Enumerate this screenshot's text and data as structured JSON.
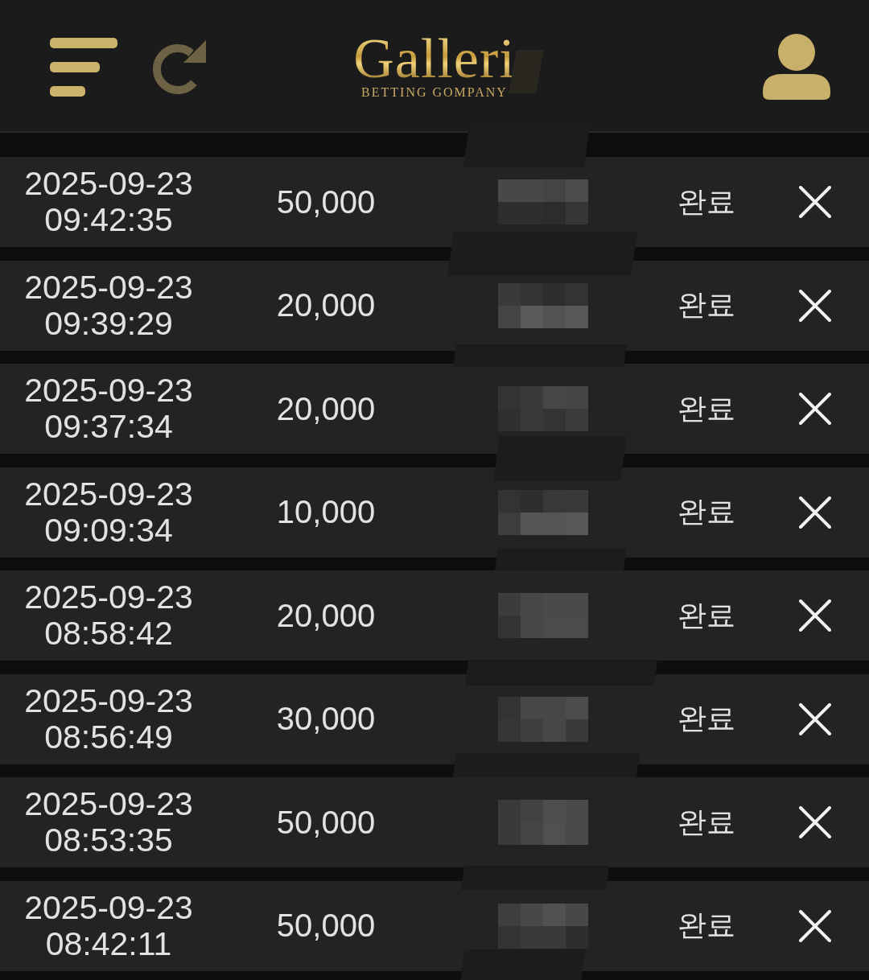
{
  "header": {
    "logo": {
      "title": "Galleri",
      "subtitle": "BETTING GOMPANY"
    }
  },
  "transactions": [
    {
      "date": "2025-09-23",
      "time": "09:42:35",
      "amount": "50,000",
      "status": "완료"
    },
    {
      "date": "2025-09-23",
      "time": "09:39:29",
      "amount": "20,000",
      "status": "완료"
    },
    {
      "date": "2025-09-23",
      "time": "09:37:34",
      "amount": "20,000",
      "status": "완료"
    },
    {
      "date": "2025-09-23",
      "time": "09:09:34",
      "amount": "10,000",
      "status": "완료"
    },
    {
      "date": "2025-09-23",
      "time": "08:58:42",
      "amount": "20,000",
      "status": "완료"
    },
    {
      "date": "2025-09-23",
      "time": "08:56:49",
      "amount": "30,000",
      "status": "완료"
    },
    {
      "date": "2025-09-23",
      "time": "08:53:35",
      "amount": "50,000",
      "status": "완료"
    },
    {
      "date": "2025-09-23",
      "time": "08:42:11",
      "amount": "50,000",
      "status": "완료"
    }
  ]
}
